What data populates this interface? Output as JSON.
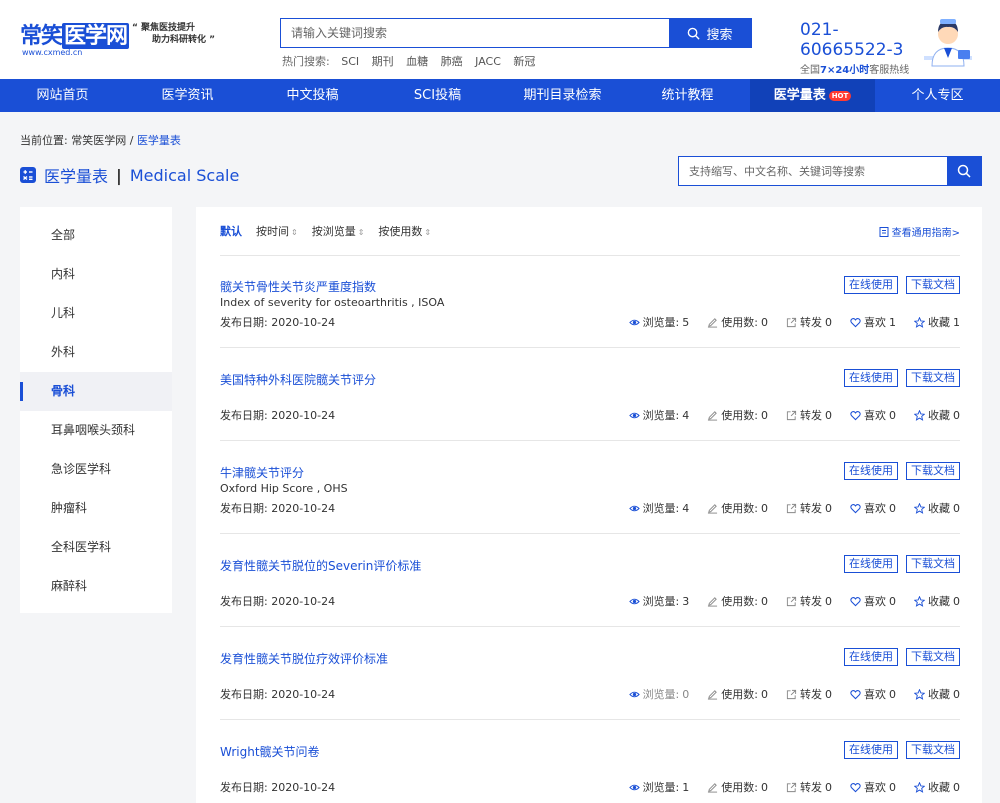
{
  "header": {
    "logo_text_a": "常笑",
    "logo_text_b": "医学网",
    "logo_url": "www.cxmed.cn",
    "slogan_1": "“ 聚焦医技提升",
    "slogan_2": "助力科研转化 ”",
    "search_placeholder": "请输入关键词搜索",
    "search_button": "搜索",
    "hot_label": "热门搜索:",
    "hot_keywords": [
      "SCI",
      "期刊",
      "血糖",
      "肺癌",
      "JACC",
      "新冠"
    ],
    "hotline_number": "021-60665522-3",
    "hotline_pre": "全国",
    "hotline_bold": "7×24小时",
    "hotline_post": "客服热线"
  },
  "nav": {
    "items": [
      "网站首页",
      "医学资讯",
      "中文投稿",
      "SCI投稿",
      "期刊目录检索",
      "统计教程",
      "医学量表",
      "个人专区"
    ],
    "hot_badge": "HOT"
  },
  "breadcrumb": {
    "label": "当前位置:",
    "home": "常笑医学网",
    "sep": "/",
    "current": "医学量表"
  },
  "page": {
    "title_cn": "医学量表",
    "title_sep": "|",
    "title_en": "Medical Scale",
    "search_placeholder": "支持缩写、中文名称、关键词等搜索"
  },
  "sidebar": {
    "items": [
      "全部",
      "内科",
      "儿科",
      "外科",
      "骨科",
      "耳鼻咽喉头颈科",
      "急诊医学科",
      "肿瘤科",
      "全科医学科",
      "麻醉科"
    ],
    "active": "骨科"
  },
  "sortbar": {
    "items": [
      "默认",
      "按时间",
      "按浏览量",
      "按使用数"
    ],
    "arrow": "⇕",
    "guide": "查看通用指南>"
  },
  "labels": {
    "date_prefix": "发布日期:",
    "views": "浏览量:",
    "uses": "使用数:",
    "forward": "转发",
    "like": "喜欢",
    "fav": "收藏",
    "btn_online": "在线使用",
    "btn_download": "下载文档"
  },
  "items": [
    {
      "title": "髋关节骨性关节炎严重度指数",
      "subtitle": "Index of severity for osteoarthritis , ISOA",
      "date": "2020-10-24",
      "views": "5",
      "uses": "0",
      "forward": "0",
      "like": "1",
      "fav": "1"
    },
    {
      "title": "美国特种外科医院髋关节评分",
      "subtitle": "",
      "date": "2020-10-24",
      "views": "4",
      "uses": "0",
      "forward": "0",
      "like": "0",
      "fav": "0"
    },
    {
      "title": "牛津髋关节评分",
      "subtitle": "Oxford Hip Score , OHS",
      "date": "2020-10-24",
      "views": "4",
      "uses": "0",
      "forward": "0",
      "like": "0",
      "fav": "0"
    },
    {
      "title": "发育性髋关节脱位的Severin评价标准",
      "subtitle": "",
      "date": "2020-10-24",
      "views": "3",
      "uses": "0",
      "forward": "0",
      "like": "0",
      "fav": "0"
    },
    {
      "title": "发育性髋关节脱位疗效评价标准",
      "subtitle": "",
      "date": "2020-10-24",
      "views": "0",
      "uses": "0",
      "forward": "0",
      "like": "0",
      "fav": "0"
    },
    {
      "title": "Wright髋关节问卷",
      "subtitle": "",
      "date": "2020-10-24",
      "views": "1",
      "uses": "0",
      "forward": "0",
      "like": "0",
      "fav": "0"
    }
  ],
  "colors": {
    "brand": "#1a4fd6",
    "nav_active": "#1141b8",
    "hot": "#ff3b30"
  }
}
